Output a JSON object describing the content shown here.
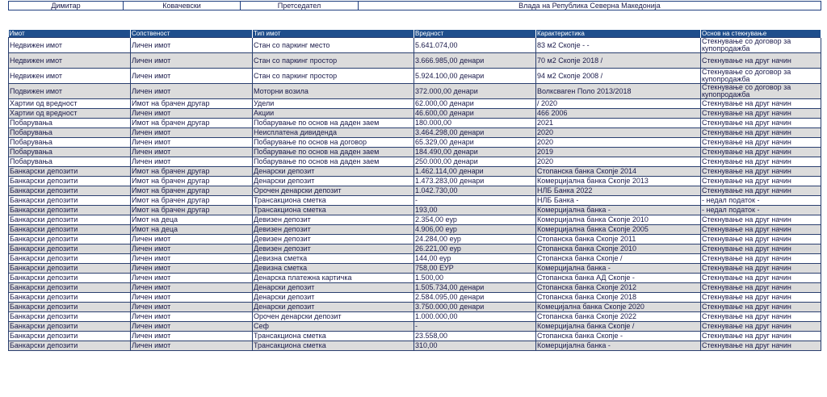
{
  "person": {
    "first_name": "Димитар",
    "last_name": "Ковачевски",
    "position": "Претседател",
    "institution": "Влада на Република Северна Македонија"
  },
  "assets": {
    "headers": [
      "Имот",
      "Сопственост",
      "Тип имот",
      "Вредност",
      "Карактеристика",
      "Основ на стекнување"
    ],
    "rows": [
      [
        "Недвижен имот",
        "Личен имот",
        "Стан со паркинг место",
        "5.641.074,00",
        "83 м2 Скопје - -",
        "Стекнување со договор за купопродажба"
      ],
      [
        "Недвижен имот",
        "Личен имот",
        "Стан со паркинг простор",
        "3.666.985,00 денари",
        "70 м2 Скопје 2018 /",
        "Стекнување на друг начин"
      ],
      [
        "Недвижен имот",
        "Личен имот",
        "Стан со паркинг простор",
        "5.924.100,00 денари",
        "94 м2 Скопје 2008 /",
        "Стекнување со договор за купопродажба"
      ],
      [
        "Подвижен имот",
        "Личен имот",
        "Моторни возила",
        "372.000,00 денари",
        "Волксваген Поло 2013/2018",
        "Стекнување со договор за купопродажба"
      ],
      [
        "Хартии од вредност",
        "Имот на брачен другар",
        "Удели",
        "62.000,00 денари",
        "/ 2020",
        "Стекнување на друг начин"
      ],
      [
        "Хартии од вредност",
        "Личен имот",
        "Акции",
        "46.600,00 денари",
        "466 2006",
        "Стекнување на друг начин"
      ],
      [
        "Побарувања",
        "Имот на брачен другар",
        "Побарување по основ на даден заем",
        "180.000,00",
        "2021",
        "Стекнување на друг начин"
      ],
      [
        "Побарувања",
        "Личен имот",
        "Неисплатена дивиденда",
        "3.464.298,00 денари",
        "2020",
        "Стекнување на друг начин"
      ],
      [
        "Побарувања",
        "Личен имот",
        "Побарување по основ на договор",
        "65.329,00 денари",
        "2020",
        "Стекнување на друг начин"
      ],
      [
        "Побарувања",
        "Личен имот",
        "Побарување по основ на даден заем",
        "184.490,00 денари",
        "2019",
        "Стекнување на друг начин"
      ],
      [
        "Побарувања",
        "Личен имот",
        "Побарување по основ на даден заем",
        "250.000,00 денари",
        "2020",
        "Стекнување на друг начин"
      ],
      [
        "Банкарски депозити",
        "Имот на брачен другар",
        "Денарски депозит",
        "1.462.114,00 денари",
        "Стопанска банка Скопје 2014",
        "Стекнување на друг начин"
      ],
      [
        "Банкарски депозити",
        "Имот на брачен другар",
        "Денарски депозит",
        "1.473.283,00 денари",
        "Комерцијална банка Скопје 2013",
        "Стекнување на друг начин"
      ],
      [
        "Банкарски депозити",
        "Имот на брачен другар",
        "Орочен денарски депозит",
        "1.042.730,00",
        "НЛБ Банка 2022",
        "Стекнување на друг начин"
      ],
      [
        "Банкарски депозити",
        "Имот на брачен другар",
        "Трансакциона сметка",
        "-",
        "НЛБ Банка -",
        "- недал податок -"
      ],
      [
        "Банкарски депозити",
        "Имот на брачен другар",
        "Трансакциона сметка",
        "193,00",
        "Комерцијална банка -",
        "- недал податок -"
      ],
      [
        "Банкарски депозити",
        "Имот на деца",
        "Девизен депозит",
        "2.354,00 еур",
        "Комерцијална банка Скопје 2010",
        "Стекнување на друг начин"
      ],
      [
        "Банкарски депозити",
        "Имот на деца",
        "Девизен депозит",
        "4.906,00 еур",
        "Комерцијална банка Скопје 2005",
        "Стекнување на друг начин"
      ],
      [
        "Банкарски депозити",
        "Личен имот",
        "Девизен депозит",
        "24.284,00 еур",
        "Стопанска банка Скопје 2011",
        "Стекнување на друг начин"
      ],
      [
        "Банкарски депозити",
        "Личен имот",
        "Девизен депозит",
        "26.221,00 еур",
        "Стопанска банка Скопје 2010",
        "Стекнување на друг начин"
      ],
      [
        "Банкарски депозити",
        "Личен имот",
        "Девизна сметка",
        "144,00 еур",
        "Стопанска банка Скопје /",
        "Стекнување на друг начин"
      ],
      [
        "Банкарски депозити",
        "Личен имот",
        "Девизна сметка",
        "758,00 ЕУР",
        "Комерцијална банка -",
        "Стекнување на друг начин"
      ],
      [
        "Банкарски депозити",
        "Личен имот",
        "Денарска платежна картичка",
        "1.500,00",
        "Стопанска банка АД Скопје -",
        "Стекнување на друг начин"
      ],
      [
        "Банкарски депозити",
        "Личен имот",
        "Денарски депозит",
        "1.505.734,00 денари",
        "Стопанска банка Скопје 2012",
        "Стекнување на друг начин"
      ],
      [
        "Банкарски депозити",
        "Личен имот",
        "Денарски депозит",
        "2.584.095,00 денари",
        "Стопанска банка Скопје 2018",
        "Стекнување на друг начин"
      ],
      [
        "Банкарски депозити",
        "Личен имот",
        "Денарски депозит",
        "3.750.000,00 денари",
        "Комецијална банка Скопје 2020",
        "Стекнување на друг начин"
      ],
      [
        "Банкарски депозити",
        "Личен имот",
        "Орочен денарски депозит",
        "1.000.000,00",
        "Стопанска банка Скопје 2022",
        "Стекнување на друг начин"
      ],
      [
        "Банкарски депозити",
        "Личен имот",
        "Сеф",
        "-",
        "Комерцијална банка Скопје /",
        "Стекнување на друг начин"
      ],
      [
        "Банкарски депозити",
        "Личен имот",
        "Трансакциона сметка",
        "23.558,00",
        "Стопанска банка Скопје -",
        "Стекнување на друг начин"
      ],
      [
        "Банкарски депозити",
        "Личен имот",
        "Трансакциона сметка",
        "310,00",
        "Комерцијална банка -",
        "Стекнување на друг начин"
      ]
    ]
  },
  "colors": {
    "header_bg": "#1f4e8c",
    "row_alt_bg": "#dcdcdc",
    "text": "#1a1a4a"
  }
}
